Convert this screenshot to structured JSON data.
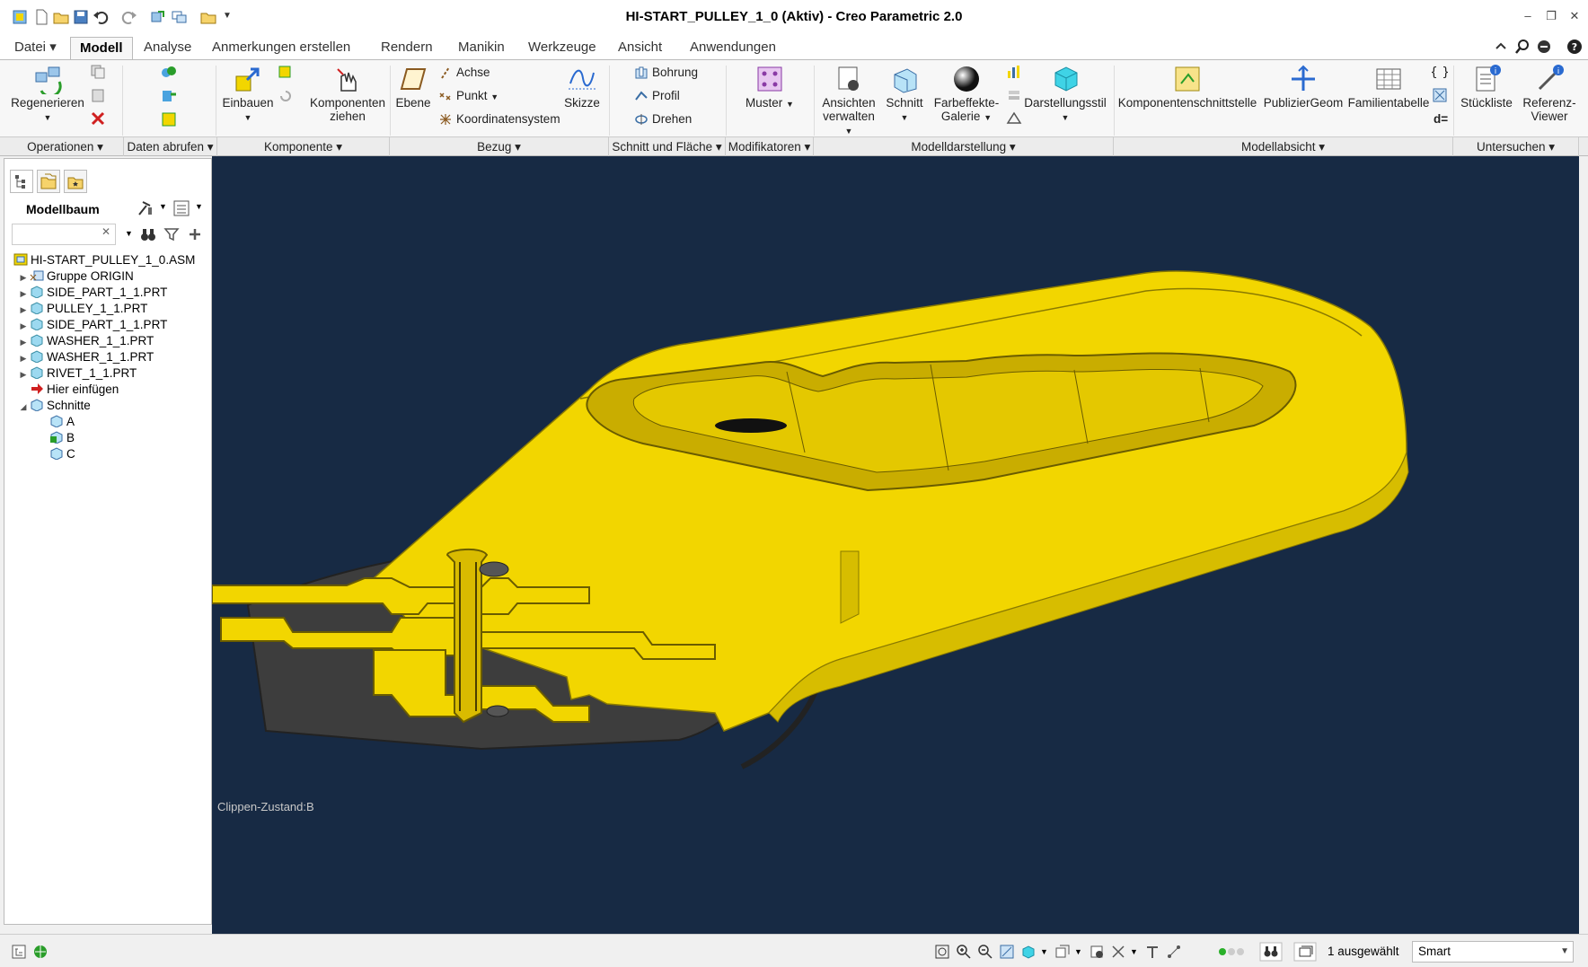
{
  "window": {
    "title": "HI-START_PULLEY_1_0 (Aktiv) - Creo Parametric 2.0"
  },
  "tabs": [
    {
      "label": "Datei"
    },
    {
      "label": "Modell",
      "active": true
    },
    {
      "label": "Analyse"
    },
    {
      "label": "Anmerkungen erstellen"
    },
    {
      "label": "Rendern"
    },
    {
      "label": "Manikin"
    },
    {
      "label": "Werkzeuge"
    },
    {
      "label": "Ansicht"
    },
    {
      "label": "Anwendungen"
    }
  ],
  "ribbon": {
    "regenerieren": "Regenerieren",
    "einbauen": "Einbauen",
    "komponenten_ziehen_1": "Komponenten",
    "komponenten_ziehen_2": "ziehen",
    "ebene": "Ebene",
    "achse": "Achse",
    "punkt": "Punkt",
    "koordinatensystem": "Koordinatensystem",
    "skizze": "Skizze",
    "bohrung": "Bohrung",
    "profil": "Profil",
    "drehen": "Drehen",
    "muster": "Muster",
    "ansichten_1": "Ansichten",
    "ansichten_2": "verwalten",
    "schnitt": "Schnitt",
    "farbeffekte_1": "Farbeffekte-",
    "farbeffekte_2": "Galerie",
    "darstellungsstil": "Darstellungsstil",
    "komponentenschnittstelle": "Komponentenschnittstelle",
    "publiziergeom": "PublizierGeom",
    "familientabelle": "Familientabelle",
    "stueckliste": "Stückliste",
    "referenz_1": "Referenz-",
    "referenz_2": "Viewer",
    "d_eq": "d="
  },
  "groups": [
    {
      "label": "Operationen"
    },
    {
      "label": "Daten abrufen"
    },
    {
      "label": "Komponente"
    },
    {
      "label": "Bezug"
    },
    {
      "label": "Schnitt und Fläche"
    },
    {
      "label": "Modifikatoren"
    },
    {
      "label": "Modelldarstellung"
    },
    {
      "label": "Modellabsicht"
    },
    {
      "label": "Untersuchen"
    }
  ],
  "left_panel": {
    "title": "Modellbaum",
    "search_value": "",
    "tree": [
      {
        "label": "HI-START_PULLEY_1_0.ASM",
        "expander": "",
        "icon": "assembly-icon"
      },
      {
        "label": "Gruppe ORIGIN",
        "expander": "▶",
        "icon": "group-icon"
      },
      {
        "label": "SIDE_PART_1_1.PRT",
        "expander": "▶",
        "icon": "part-icon"
      },
      {
        "label": "PULLEY_1_1.PRT",
        "expander": "▶",
        "icon": "part-icon"
      },
      {
        "label": "SIDE_PART_1_1.PRT",
        "expander": "▶",
        "icon": "part-icon"
      },
      {
        "label": "WASHER_1_1.PRT",
        "expander": "▶",
        "icon": "part-icon"
      },
      {
        "label": "WASHER_1_1.PRT",
        "expander": "▶",
        "icon": "part-icon"
      },
      {
        "label": "RIVET_1_1.PRT",
        "expander": "▶",
        "icon": "part-icon"
      },
      {
        "label": "Hier einfügen",
        "expander": "",
        "icon": "insert-arrow-icon"
      },
      {
        "label": "Schnitte",
        "expander": "◢",
        "icon": "sections-icon"
      },
      {
        "label": "A",
        "expander": "",
        "icon": "section-icon"
      },
      {
        "label": "B",
        "expander": "",
        "icon": "section-active-icon"
      },
      {
        "label": "C",
        "expander": "",
        "icon": "section-icon"
      }
    ]
  },
  "viewport": {
    "clip_state": "Clippen-Zustand:B"
  },
  "status": {
    "selected": "1 ausgewählt",
    "filter": "Smart"
  },
  "colors": {
    "viewport_bg": "#172a44",
    "model_yellow": "#f2d600",
    "model_dark": "#4a4a4a"
  }
}
